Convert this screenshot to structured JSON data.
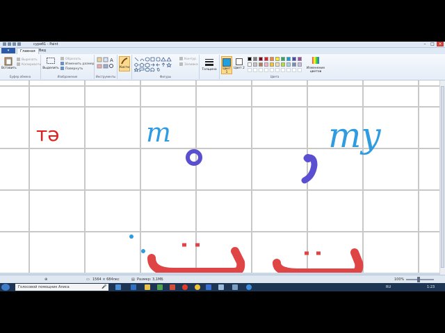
{
  "window": {
    "title": "сурәб1 - Paint"
  },
  "tabs": {
    "file": "",
    "home": "Главная",
    "view": "Вид"
  },
  "ribbon": {
    "clipboard": {
      "paste": "Вставить",
      "cut": "Вырезать",
      "copy": "Копировать",
      "label": "Буфер обмена"
    },
    "image": {
      "select": "Выделить",
      "crop": "Обрезать",
      "resize": "Изменить размер",
      "rotate": "Повернуть",
      "label": "Изображение"
    },
    "tools": {
      "label": "Инструменты"
    },
    "brushes": {
      "label": "Кисти"
    },
    "shapes": {
      "outline": "Контур",
      "fill": "Заливка",
      "label": "Фигуры"
    },
    "size": {
      "label": "Толщина"
    },
    "colors": {
      "color1": "Цвет 1",
      "color2": "Цвет 2",
      "edit": "Изменение цветов",
      "label": "Цвета",
      "palette": [
        "#000000",
        "#7f7f7f",
        "#880015",
        "#ed1c24",
        "#ff7f27",
        "#fff200",
        "#22b14c",
        "#00a2e8",
        "#3f48cc",
        "#a349a4",
        "#ffffff",
        "#c3c3c3",
        "#b97a57",
        "#ffaec9",
        "#ffc90e",
        "#efe4b0",
        "#b5e61d",
        "#99d9ea",
        "#7092be",
        "#c8bfe7"
      ],
      "current1": "#1ba1e2",
      "current2": "#ffffff"
    }
  },
  "canvas": {
    "text_red": "тә",
    "text_blue_1": "m",
    "text_blue_2": "my",
    "red_color": "#e02020",
    "blue_color": "#2f9be0",
    "purple_color": "#5a4fd0",
    "grid_color": "#c8c8c8"
  },
  "statusbar": {
    "dimensions": "1564 × 684пкс",
    "size": "Размер: 3,1МБ",
    "zoom": "100%"
  },
  "taskbar": {
    "search": "Голосовой помощник Алиса",
    "lang": "RU",
    "time": "1:23"
  }
}
